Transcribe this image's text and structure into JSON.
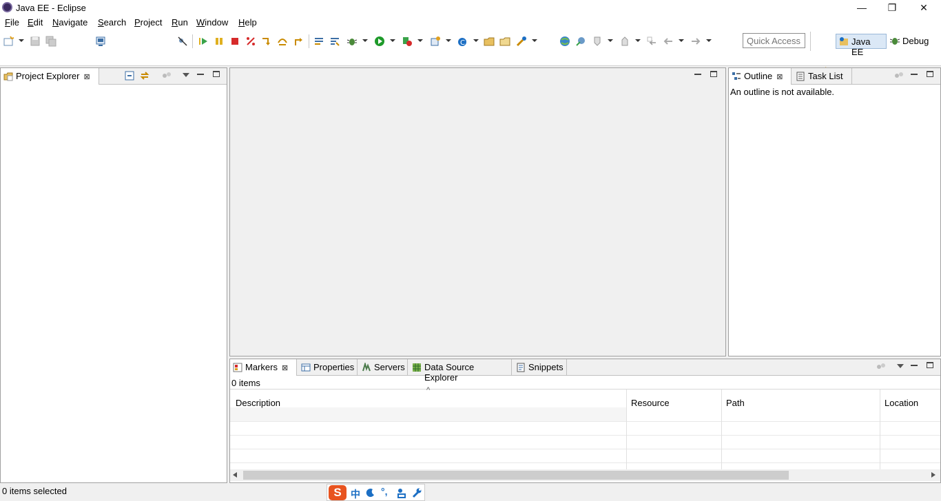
{
  "window": {
    "title": "Java EE - Eclipse",
    "minimize_glyph": "—",
    "restore_glyph": "❐",
    "close_glyph": "✕"
  },
  "menu": [
    {
      "label": "File",
      "mnemonic": "F",
      "rest": "ile"
    },
    {
      "label": "Edit",
      "mnemonic": "E",
      "rest": "dit"
    },
    {
      "label": "Navigate",
      "mnemonic": "N",
      "rest": "avigate"
    },
    {
      "label": "Search",
      "mnemonic": "S",
      "rest": "earch"
    },
    {
      "label": "Project",
      "mnemonic": "P",
      "rest": "roject"
    },
    {
      "label": "Run",
      "mnemonic": "R",
      "rest": "un"
    },
    {
      "label": "Window",
      "mnemonic": "W",
      "rest": "indow"
    },
    {
      "label": "Help",
      "mnemonic": "H",
      "rest": "elp"
    }
  ],
  "toolbar": {
    "quick_access_placeholder": "Quick Access",
    "perspectives": [
      {
        "label": "Java EE",
        "active": true
      },
      {
        "label": "Debug",
        "active": false
      }
    ]
  },
  "project_explorer": {
    "tab_label": "Project Explorer",
    "close_glyph": "⊠"
  },
  "outline": {
    "tabs": [
      {
        "label": "Outline",
        "active": true
      },
      {
        "label": "Task List",
        "active": false
      }
    ],
    "message": "An outline is not available."
  },
  "bottom_panel": {
    "tabs": [
      {
        "label": "Markers",
        "active": true
      },
      {
        "label": "Properties",
        "active": false
      },
      {
        "label": "Servers",
        "active": false
      },
      {
        "label": "Data Source Explorer",
        "active": false
      },
      {
        "label": "Snippets",
        "active": false
      }
    ],
    "item_count": "0 items",
    "columns": [
      "Description",
      "Resource",
      "Path",
      "Location"
    ],
    "sort_glyph": "^"
  },
  "status": {
    "text": "0 items selected",
    "ime": {
      "logo": "S",
      "lang": "中"
    }
  },
  "colors": {
    "accent_blue": "#1c6fc4",
    "run_green": "#1e9a2a",
    "stop_red": "#d62b2b",
    "ime_orange": "#e8531f"
  }
}
